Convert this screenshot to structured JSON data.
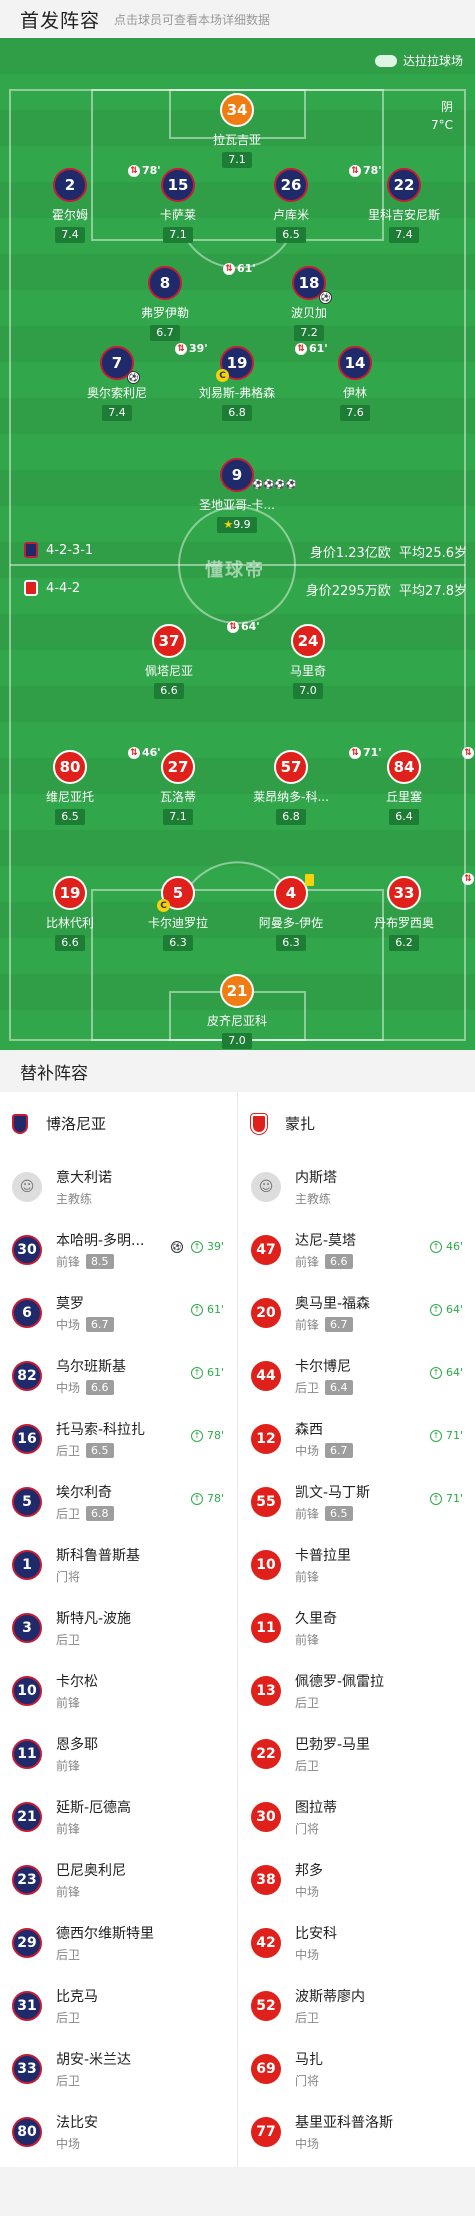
{
  "header": {
    "title": "首发阵容",
    "subtitle": "点击球员可查看本场详细数据"
  },
  "venue": {
    "name": "达拉拉球场",
    "icon": "stadium-icon"
  },
  "weather": {
    "condition": "阴",
    "temp": "7°C"
  },
  "watermark": "懂球帝",
  "home": {
    "formation": "4-2-3-1",
    "value_text": "身价1.23亿欧",
    "age_text": "平均25.6岁",
    "color": "#1e2a6a"
  },
  "away": {
    "formation": "4-4-2",
    "value_text": "身价2295万欧",
    "age_text": "平均27.8岁",
    "color": "#e0201b"
  },
  "pitch_home": [
    {
      "num": "34",
      "name": "拉瓦吉亚",
      "rating": "7.1",
      "kind": "gk"
    },
    {
      "num": "2",
      "name": "霍尔姆",
      "rating": "7.4",
      "sub": "78'"
    },
    {
      "num": "15",
      "name": "卡萨莱",
      "rating": "7.1"
    },
    {
      "num": "26",
      "name": "卢库米",
      "rating": "6.5",
      "sub": "78'"
    },
    {
      "num": "22",
      "name": "里科吉安尼斯",
      "rating": "7.4"
    },
    {
      "num": "8",
      "name": "弗罗伊勒",
      "rating": "6.7",
      "sub": "61'"
    },
    {
      "num": "18",
      "name": "波贝加",
      "rating": "7.2",
      "ball": "⚽"
    },
    {
      "num": "7",
      "name": "奥尔索利尼",
      "rating": "7.4",
      "sub": "39'",
      "ball": "⚽"
    },
    {
      "num": "19",
      "name": "刘易斯-弗格森",
      "rating": "6.8",
      "sub": "61'",
      "captain": "C"
    },
    {
      "num": "14",
      "name": "伊林",
      "rating": "7.6"
    },
    {
      "num": "9",
      "name": "圣地亚哥-卡...",
      "rating": "9.9",
      "goals": "⚽⚽⚽⚽",
      "star": "★"
    }
  ],
  "pitch_away": [
    {
      "num": "37",
      "name": "佩塔尼亚",
      "rating": "6.6",
      "sub": "64'"
    },
    {
      "num": "24",
      "name": "马里奇",
      "rating": "7.0"
    },
    {
      "num": "80",
      "name": "维尼亚托",
      "rating": "6.5",
      "sub": "46'"
    },
    {
      "num": "27",
      "name": "瓦洛蒂",
      "rating": "7.1"
    },
    {
      "num": "57",
      "name": "莱昂纳多-科...",
      "rating": "6.8",
      "sub": "71'"
    },
    {
      "num": "84",
      "name": "丘里塞",
      "rating": "6.4",
      "sub": "71'"
    },
    {
      "num": "19",
      "name": "比林代利",
      "rating": "6.6"
    },
    {
      "num": "5",
      "name": "卡尔迪罗拉",
      "rating": "6.3",
      "captain": "C"
    },
    {
      "num": "4",
      "name": "阿曼多-伊佐",
      "rating": "6.3",
      "yellow": true
    },
    {
      "num": "33",
      "name": "丹布罗西奥",
      "rating": "6.2",
      "sub": "64'"
    },
    {
      "num": "21",
      "name": "皮齐尼亚科",
      "rating": "7.0",
      "kind": "gk"
    }
  ],
  "subs_title": "替补阵容",
  "subs_home": {
    "team": "博洛尼亚",
    "coach": {
      "name": "意大利诺",
      "role": "主教练"
    },
    "players": [
      {
        "num": "30",
        "name": "本哈明-多明...",
        "pos": "前锋",
        "rating": "8.5",
        "event": "39'",
        "goal": "⚽"
      },
      {
        "num": "6",
        "name": "莫罗",
        "pos": "中场",
        "rating": "6.7",
        "event": "61'"
      },
      {
        "num": "82",
        "name": "乌尔班斯基",
        "pos": "中场",
        "rating": "6.6",
        "event": "61'"
      },
      {
        "num": "16",
        "name": "托马索-科拉扎",
        "pos": "后卫",
        "rating": "6.5",
        "event": "78'"
      },
      {
        "num": "5",
        "name": "埃尔利奇",
        "pos": "后卫",
        "rating": "6.8",
        "event": "78'"
      },
      {
        "num": "1",
        "name": "斯科鲁普斯基",
        "pos": "门将"
      },
      {
        "num": "3",
        "name": "斯特凡-波施",
        "pos": "后卫"
      },
      {
        "num": "10",
        "name": "卡尔松",
        "pos": "前锋"
      },
      {
        "num": "11",
        "name": "恩多耶",
        "pos": "前锋"
      },
      {
        "num": "21",
        "name": "延斯-厄德高",
        "pos": "前锋"
      },
      {
        "num": "23",
        "name": "巴尼奥利尼",
        "pos": "前锋"
      },
      {
        "num": "29",
        "name": "德西尔维斯特里",
        "pos": "后卫"
      },
      {
        "num": "31",
        "name": "比克马",
        "pos": "后卫"
      },
      {
        "num": "33",
        "name": "胡安-米兰达",
        "pos": "后卫"
      },
      {
        "num": "80",
        "name": "法比安",
        "pos": "中场"
      }
    ]
  },
  "subs_away": {
    "team": "蒙扎",
    "coach": {
      "name": "内斯塔",
      "role": "主教练"
    },
    "players": [
      {
        "num": "47",
        "name": "达尼-莫塔",
        "pos": "前锋",
        "rating": "6.6",
        "event": "46'"
      },
      {
        "num": "20",
        "name": "奥马里-福森",
        "pos": "前锋",
        "rating": "6.7",
        "event": "64'"
      },
      {
        "num": "44",
        "name": "卡尔博尼",
        "pos": "后卫",
        "rating": "6.4",
        "event": "64'"
      },
      {
        "num": "12",
        "name": "森西",
        "pos": "中场",
        "rating": "6.7",
        "event": "71'"
      },
      {
        "num": "55",
        "name": "凯文-马丁斯",
        "pos": "前锋",
        "rating": "6.5",
        "event": "71'"
      },
      {
        "num": "10",
        "name": "卡普拉里",
        "pos": "前锋"
      },
      {
        "num": "11",
        "name": "久里奇",
        "pos": "前锋"
      },
      {
        "num": "13",
        "name": "佩德罗-佩雷拉",
        "pos": "后卫"
      },
      {
        "num": "22",
        "name": "巴勃罗-马里",
        "pos": "后卫"
      },
      {
        "num": "30",
        "name": "图拉蒂",
        "pos": "门将"
      },
      {
        "num": "38",
        "name": "邦多",
        "pos": "中场"
      },
      {
        "num": "42",
        "name": "比安科",
        "pos": "中场"
      },
      {
        "num": "52",
        "name": "波斯蒂廖内",
        "pos": "后卫"
      },
      {
        "num": "69",
        "name": "马扎",
        "pos": "门将"
      },
      {
        "num": "77",
        "name": "基里亚科普洛斯",
        "pos": "中场"
      }
    ]
  }
}
